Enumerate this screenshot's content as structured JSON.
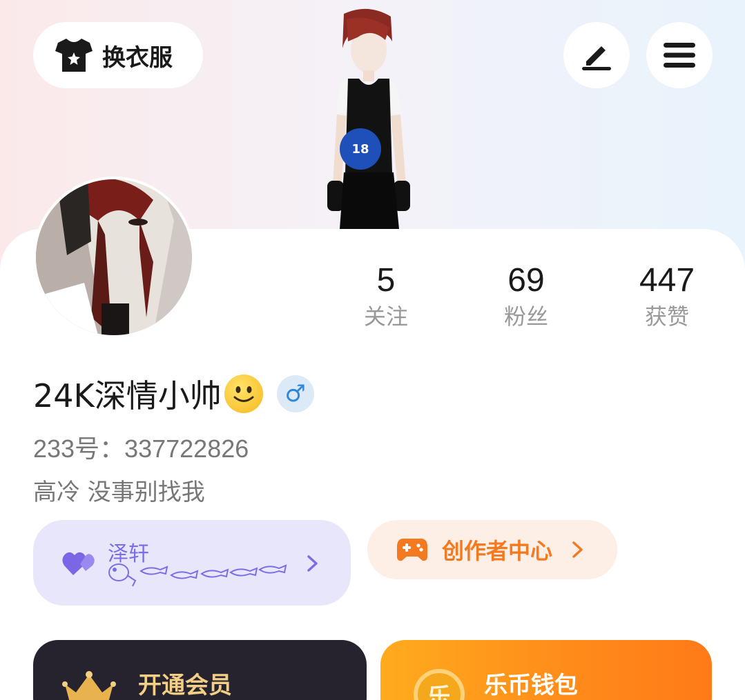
{
  "header": {
    "outfit_button_label": "换衣服",
    "edit_icon": "pen-icon",
    "menu_icon": "hamburger-menu-icon"
  },
  "stats": [
    {
      "value": "5",
      "label": "关注"
    },
    {
      "value": "69",
      "label": "粉丝"
    },
    {
      "value": "447",
      "label": "获赞"
    }
  ],
  "profile": {
    "username": "24K深情小帅",
    "gender_symbol": "♂",
    "id_line": "233号：337722826",
    "bio": "高冷  没事别找我"
  },
  "bond": {
    "name": "泽轩",
    "icon": "double-heart-icon"
  },
  "creator": {
    "label": "创作者中心",
    "icon": "gamepad-icon"
  },
  "vip": {
    "title": "开通会员",
    "icon": "crown-icon"
  },
  "wallet": {
    "title": "乐币钱包",
    "coin_glyph": "乐"
  },
  "colors": {
    "accent_purple": "#7a6ee6",
    "accent_orange": "#f47a22",
    "vip_gold": "#f3cf86",
    "gender_blue": "#2e86e0"
  }
}
